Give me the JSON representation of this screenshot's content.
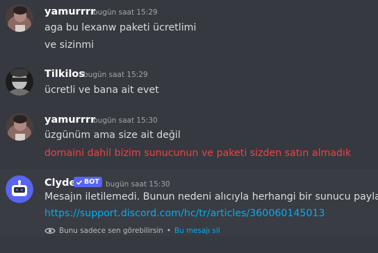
{
  "messages": [
    {
      "author": "yamurrrr",
      "timestamp": "bugün saat 15:29",
      "lines": [
        "aga bu lexanw paketi ücretlimi",
        "ve sizinmi"
      ]
    },
    {
      "author": "Tilkilos",
      "timestamp": "bugün saat 15:29",
      "lines": [
        "ücretli ve bana ait evet"
      ]
    },
    {
      "author": "yamurrrr",
      "timestamp": "bugün saat 15:30",
      "lines": [
        "üzgünüm ama size ait değil",
        "domaini dahil bizim sunucunun ve paketi sizden satın almadık"
      ]
    },
    {
      "author": "Clyde",
      "badge": "BOT",
      "timestamp": "bugün saat 15:30",
      "lines": [
        "Mesajın iletilemedi. Bunun nedeni alıcıyla herhangi bir sunucu paylaşmıyor"
      ],
      "link": "https://support.discord.com/hc/tr/articles/360060145013",
      "ephemeral_note": "Bunu sadece sen görebilirsin",
      "separator": "•",
      "dismiss_label": "Bu mesajı sil"
    }
  ],
  "colors": {
    "background": "#36393f",
    "error_text": "#ed4245",
    "link": "#00aff4",
    "bot_badge": "#5865f2"
  },
  "icons": [
    "verified-check-icon",
    "eye-icon"
  ]
}
